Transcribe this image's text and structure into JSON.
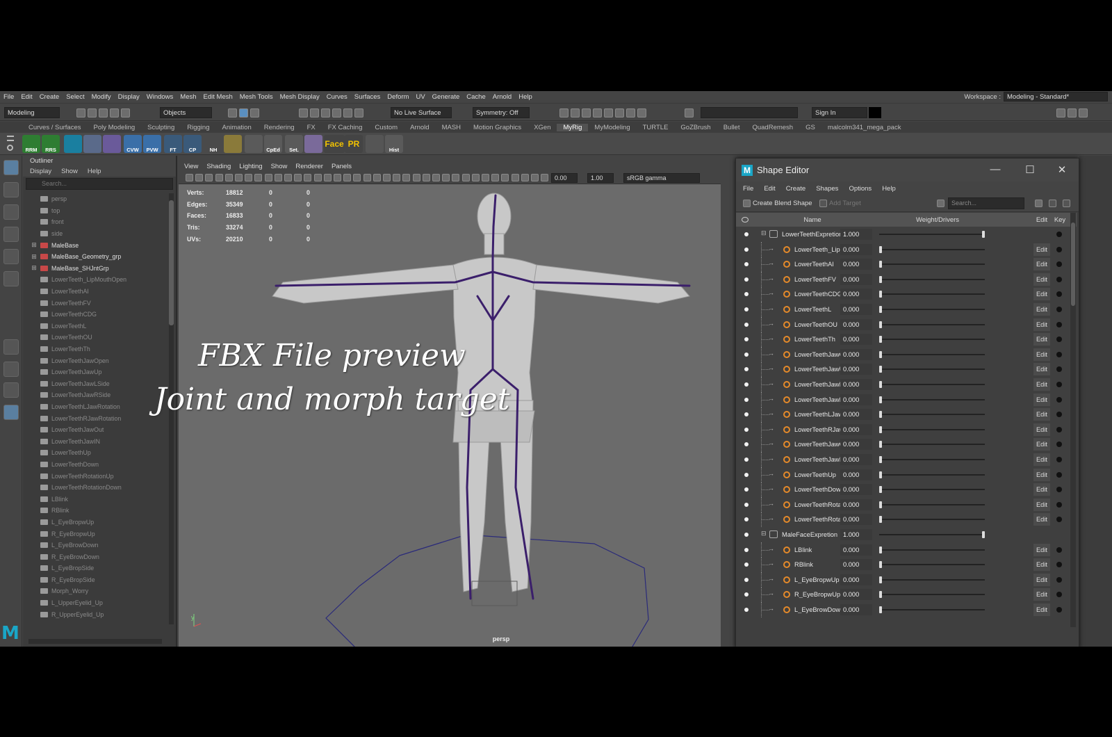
{
  "menu": [
    "File",
    "Edit",
    "Create",
    "Select",
    "Modify",
    "Display",
    "Windows",
    "Mesh",
    "Edit Mesh",
    "Mesh Tools",
    "Mesh Display",
    "Curves",
    "Surfaces",
    "Deform",
    "UV",
    "Generate",
    "Cache",
    "Arnold",
    "Help"
  ],
  "workspace": {
    "label": "Workspace :",
    "value": "Modeling - Standard*"
  },
  "statusline": {
    "mode": "Modeling",
    "objects": "Objects",
    "live_surface": "No Live Surface",
    "symmetry": "Symmetry: Off",
    "sign_in": "Sign In"
  },
  "shelf_tabs": [
    "Curves / Surfaces",
    "Poly Modeling",
    "Sculpting",
    "Rigging",
    "Animation",
    "Rendering",
    "FX",
    "FX Caching",
    "Custom",
    "Arnold",
    "MASH",
    "Motion Graphics",
    "XGen",
    "MyRig",
    "MyModeling",
    "TURTLE",
    "GoZBrush",
    "Bullet",
    "QuadRemesh",
    "GS",
    "malcolm341_mega_pack"
  ],
  "shelf_active": "MyRig",
  "shelf_buttons": [
    {
      "label": "RRM",
      "color": "#2e7d32"
    },
    {
      "label": "RRS",
      "color": "#2e7d32"
    },
    {
      "label": "",
      "color": "#1a7fa0"
    },
    {
      "label": "",
      "color": "#5a6a8a"
    },
    {
      "label": "",
      "color": "#6a5a9a"
    },
    {
      "label": "CVW",
      "color": "#3a6fa8"
    },
    {
      "label": "PVW",
      "color": "#3a6fa8"
    },
    {
      "label": "FT",
      "color": "#3a5a7a"
    },
    {
      "label": "CP",
      "color": "#3a5a7a"
    },
    {
      "label": "NH",
      "color": "#4a4a4a"
    },
    {
      "label": "",
      "color": "#8a7a3a"
    },
    {
      "label": "",
      "color": "#5a5a5a"
    },
    {
      "label": "CpEd",
      "color": "#5a5a5a"
    },
    {
      "label": "Set.",
      "color": "#5a5a5a"
    },
    {
      "label": "",
      "color": "#7a6a9a"
    },
    {
      "label": "Face",
      "color": "#444444"
    },
    {
      "label": "PR",
      "color": "#444444"
    },
    {
      "label": "",
      "color": "#555555"
    },
    {
      "label": "Hist",
      "color": "#5a5a5a"
    }
  ],
  "outliner": {
    "title": "Outliner",
    "menu": [
      "Display",
      "Show",
      "Help"
    ],
    "search_placeholder": "Search...",
    "items": [
      {
        "name": "persp",
        "type": "camera",
        "dim": true
      },
      {
        "name": "top",
        "type": "camera",
        "dim": true
      },
      {
        "name": "front",
        "type": "camera",
        "dim": true
      },
      {
        "name": "side",
        "type": "camera",
        "dim": true
      },
      {
        "name": "MaleBase",
        "type": "group",
        "dim": false
      },
      {
        "name": "MaleBase_Geometry_grp",
        "type": "group",
        "dim": false
      },
      {
        "name": "MaleBase_SHJntGrp",
        "type": "group",
        "dim": false
      },
      {
        "name": "LowerTeeth_LipMouthOpen",
        "type": "mesh",
        "dim": true
      },
      {
        "name": "LowerTeethAI",
        "type": "mesh",
        "dim": true
      },
      {
        "name": "LowerTeethFV",
        "type": "mesh",
        "dim": true
      },
      {
        "name": "LowerTeethCDG",
        "type": "mesh",
        "dim": true
      },
      {
        "name": "LowerTeethL",
        "type": "mesh",
        "dim": true
      },
      {
        "name": "LowerTeethOU",
        "type": "mesh",
        "dim": true
      },
      {
        "name": "LowerTeethTh",
        "type": "mesh",
        "dim": true
      },
      {
        "name": "LowerTeethJawOpen",
        "type": "mesh",
        "dim": true
      },
      {
        "name": "LowerTeethJawUp",
        "type": "mesh",
        "dim": true
      },
      {
        "name": "LowerTeethJawLSide",
        "type": "mesh",
        "dim": true
      },
      {
        "name": "LowerTeethJawRSide",
        "type": "mesh",
        "dim": true
      },
      {
        "name": "LowerTeethLJawRotation",
        "type": "mesh",
        "dim": true
      },
      {
        "name": "LowerTeethRJawRotation",
        "type": "mesh",
        "dim": true
      },
      {
        "name": "LowerTeethJawOut",
        "type": "mesh",
        "dim": true
      },
      {
        "name": "LowerTeethJawIN",
        "type": "mesh",
        "dim": true
      },
      {
        "name": "LowerTeethUp",
        "type": "mesh",
        "dim": true
      },
      {
        "name": "LowerTeethDown",
        "type": "mesh",
        "dim": true
      },
      {
        "name": "LowerTeethRotationUp",
        "type": "mesh",
        "dim": true
      },
      {
        "name": "LowerTeethRotationDown",
        "type": "mesh",
        "dim": true
      },
      {
        "name": "LBlink",
        "type": "mesh",
        "dim": true
      },
      {
        "name": "RBlink",
        "type": "mesh",
        "dim": true
      },
      {
        "name": "L_EyeBropwUp",
        "type": "mesh",
        "dim": true
      },
      {
        "name": "R_EyeBropwUp",
        "type": "mesh",
        "dim": true
      },
      {
        "name": "L_EyeBrowDown",
        "type": "mesh",
        "dim": true
      },
      {
        "name": "R_EyeBrowDown",
        "type": "mesh",
        "dim": true
      },
      {
        "name": "L_EyeBropSide",
        "type": "mesh",
        "dim": true
      },
      {
        "name": "R_EyeBropSide",
        "type": "mesh",
        "dim": true
      },
      {
        "name": "Morph_Worry",
        "type": "mesh",
        "dim": true
      },
      {
        "name": "L_UpperEyelid_Up",
        "type": "mesh",
        "dim": true
      },
      {
        "name": "R_UpperEyelid_Up",
        "type": "mesh",
        "dim": true
      }
    ]
  },
  "viewport": {
    "menu": [
      "View",
      "Shading",
      "Lighting",
      "Show",
      "Renderer",
      "Panels"
    ],
    "field_a": "0.00",
    "field_b": "1.00",
    "colorspace": "sRGB gamma",
    "camera_label": "persp",
    "hud": [
      {
        "label": "Verts:",
        "value": "18812",
        "a": "0",
        "b": "0"
      },
      {
        "label": "Edges:",
        "value": "35349",
        "a": "0",
        "b": "0"
      },
      {
        "label": "Faces:",
        "value": "16833",
        "a": "0",
        "b": "0"
      },
      {
        "label": "Tris:",
        "value": "33274",
        "a": "0",
        "b": "0"
      },
      {
        "label": "UVs:",
        "value": "20210",
        "a": "0",
        "b": "0"
      }
    ]
  },
  "overlay": {
    "line1": "FBX File preview",
    "line2": "Joint and morph target"
  },
  "shape_editor": {
    "title": "Shape Editor",
    "menu": [
      "File",
      "Edit",
      "Create",
      "Shapes",
      "Options",
      "Help"
    ],
    "create_blend_shape": "Create Blend Shape",
    "add_target": "Add Target",
    "search_placeholder": "Search...",
    "columns": {
      "name": "Name",
      "weight": "Weight/Drivers",
      "edit": "Edit",
      "key": "Key"
    },
    "edit_label": "Edit",
    "rows": [
      {
        "kind": "group",
        "name": "LowerTeethExpretion",
        "value": "1.000",
        "fraction": 1.0
      },
      {
        "kind": "target",
        "name": "LowerTeeth_LipMouthOpen",
        "value": "0.000",
        "fraction": 0.0
      },
      {
        "kind": "target",
        "name": "LowerTeethAI",
        "value": "0.000",
        "fraction": 0.0
      },
      {
        "kind": "target",
        "name": "LowerTeethFV",
        "value": "0.000",
        "fraction": 0.0
      },
      {
        "kind": "target",
        "name": "LowerTeethCDG",
        "value": "0.000",
        "fraction": 0.0
      },
      {
        "kind": "target",
        "name": "LowerTeethL",
        "value": "0.000",
        "fraction": 0.0
      },
      {
        "kind": "target",
        "name": "LowerTeethOU",
        "value": "0.000",
        "fraction": 0.0
      },
      {
        "kind": "target",
        "name": "LowerTeethTh",
        "value": "0.000",
        "fraction": 0.0
      },
      {
        "kind": "target",
        "name": "LowerTeethJawOpen",
        "value": "0.000",
        "fraction": 0.0
      },
      {
        "kind": "target",
        "name": "LowerTeethJawUp",
        "value": "0.000",
        "fraction": 0.0
      },
      {
        "kind": "target",
        "name": "LowerTeethJawLSide",
        "value": "0.000",
        "fraction": 0.0
      },
      {
        "kind": "target",
        "name": "LowerTeethJawRSide",
        "value": "0.000",
        "fraction": 0.0
      },
      {
        "kind": "target",
        "name": "LowerTeethLJawRotation",
        "value": "0.000",
        "fraction": 0.0
      },
      {
        "kind": "target",
        "name": "LowerTeethRJawRotation",
        "value": "0.000",
        "fraction": 0.0
      },
      {
        "kind": "target",
        "name": "LowerTeethJawOut",
        "value": "0.000",
        "fraction": 0.0
      },
      {
        "kind": "target",
        "name": "LowerTeethJawIN",
        "value": "0.000",
        "fraction": 0.0
      },
      {
        "kind": "target",
        "name": "LowerTeethUp",
        "value": "0.000",
        "fraction": 0.0
      },
      {
        "kind": "target",
        "name": "LowerTeethDown",
        "value": "0.000",
        "fraction": 0.0
      },
      {
        "kind": "target",
        "name": "LowerTeethRotationUp",
        "value": "0.000",
        "fraction": 0.0
      },
      {
        "kind": "target",
        "name": "LowerTeethRotationDown",
        "value": "0.000",
        "fraction": 0.0
      },
      {
        "kind": "group",
        "name": "MaleFaceExpretion",
        "value": "1.000",
        "fraction": 1.0
      },
      {
        "kind": "target",
        "name": "LBlink",
        "value": "0.000",
        "fraction": 0.0
      },
      {
        "kind": "target",
        "name": "RBlink",
        "value": "0.000",
        "fraction": 0.0
      },
      {
        "kind": "target",
        "name": "L_EyeBropwUp",
        "value": "0.000",
        "fraction": 0.0
      },
      {
        "kind": "target",
        "name": "R_EyeBropwUp",
        "value": "0.000",
        "fraction": 0.0
      },
      {
        "kind": "target",
        "name": "L_EyeBrowDown",
        "value": "0.000",
        "fraction": 0.0
      }
    ]
  },
  "colors": {
    "accent": "#1aa6c7",
    "skeleton": "#3b1f6b",
    "target_icon": "#e58a2a"
  }
}
